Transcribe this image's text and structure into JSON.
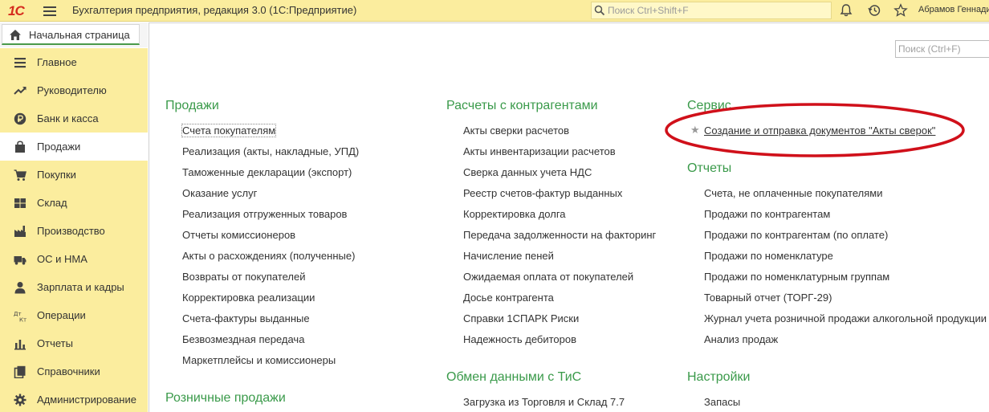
{
  "topbar": {
    "logo": "1С",
    "title": "Бухгалтерия предприятия, редакция 3.0  (1С:Предприятие)",
    "search_placeholder": "Поиск Ctrl+Shift+F",
    "user": "Абрамов Геннадий"
  },
  "home_tab": {
    "label": "Начальная страница"
  },
  "sidebar": {
    "items": [
      {
        "label": "Главное",
        "icon": "menu-icon"
      },
      {
        "label": "Руководителю",
        "icon": "trend-icon"
      },
      {
        "label": "Банк и касса",
        "icon": "ruble-icon"
      },
      {
        "label": "Продажи",
        "icon": "bag-icon",
        "active": true
      },
      {
        "label": "Покупки",
        "icon": "cart-icon"
      },
      {
        "label": "Склад",
        "icon": "warehouse-icon"
      },
      {
        "label": "Производство",
        "icon": "factory-icon"
      },
      {
        "label": "ОС и НМА",
        "icon": "truck-icon"
      },
      {
        "label": "Зарплата и кадры",
        "icon": "person-icon"
      },
      {
        "label": "Операции",
        "icon": "dt-kt-icon"
      },
      {
        "label": "Отчеты",
        "icon": "bar-chart-icon"
      },
      {
        "label": "Справочники",
        "icon": "books-icon"
      },
      {
        "label": "Администрирование",
        "icon": "gear-icon"
      }
    ]
  },
  "main": {
    "search_placeholder": "Поиск (Ctrl+F)",
    "col1": {
      "sales_title": "Продажи",
      "sales_links": [
        "Счета покупателям",
        "Реализация (акты, накладные, УПД)",
        "Таможенные декларации (экспорт)",
        "Оказание услуг",
        "Реализация отгруженных товаров",
        "Отчеты комиссионеров",
        "Акты о расхождениях (полученные)",
        "Возвраты от покупателей",
        "Корректировка реализации",
        "Счета-фактуры выданные",
        "Безвозмездная передача",
        "Маркетплейсы и комиссионеры"
      ],
      "retail_title": "Розничные продажи"
    },
    "col2": {
      "settlements_title": "Расчеты с контрагентами",
      "settlements_links": [
        "Акты сверки расчетов",
        "Акты инвентаризации расчетов",
        "Сверка данных учета НДС",
        "Реестр счетов-фактур выданных",
        "Корректировка долга",
        "Передача задолженности на факторинг",
        "Начисление пеней",
        "Ожидаемая оплата от покупателей",
        "Досье контрагента",
        "Справки 1СПАРК Риски",
        "Надежность дебиторов"
      ],
      "exchange_title": "Обмен данными с ТиС",
      "exchange_links": [
        "Загрузка из Торговля и Склад 7.7"
      ]
    },
    "col3": {
      "service_title": "Сервис",
      "service_links": [
        "Создание и отправка документов \"Акты сверок\""
      ],
      "reports_title": "Отчеты",
      "reports_links": [
        "Счета, не оплаченные покупателями",
        "Продажи по контрагентам",
        "Продажи по контрагентам (по оплате)",
        "Продажи по номенклатуре",
        "Продажи по номенклатурным группам",
        "Товарный отчет (ТОРГ-29)",
        "Журнал учета розничной продажи алкогольной продукции",
        "Анализ продаж"
      ],
      "settings_title": "Настройки",
      "settings_links": [
        "Запасы"
      ]
    }
  },
  "colors": {
    "accent_green": "#3a9a4a",
    "topbar_bg": "#fbed9e",
    "annotation_red": "#d0101a"
  }
}
